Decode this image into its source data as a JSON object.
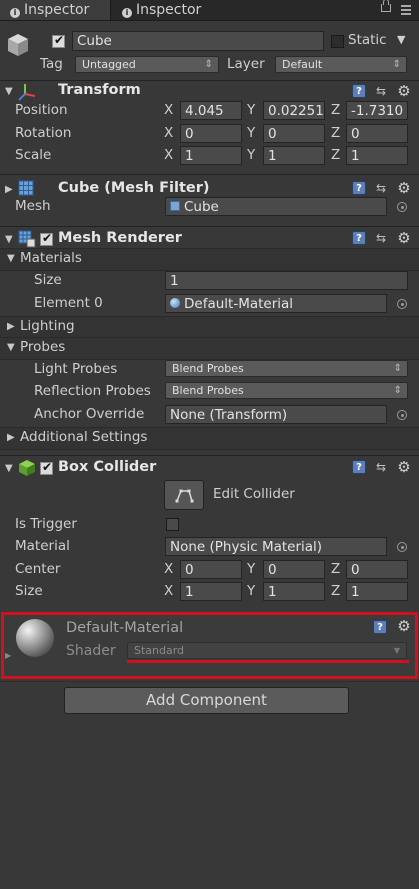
{
  "tabs": [
    {
      "label": "Inspector"
    },
    {
      "label": "Inspector"
    }
  ],
  "object": {
    "name": "Cube",
    "active": true,
    "static_label": "Static",
    "static": false,
    "tag_label": "Tag",
    "tag_value": "Untagged",
    "layer_label": "Layer",
    "layer_value": "Default"
  },
  "transform": {
    "title": "Transform",
    "rows": [
      {
        "label": "Position",
        "x": "4.045",
        "y": "0.02251",
        "z": "-1.7310"
      },
      {
        "label": "Rotation",
        "x": "0",
        "y": "0",
        "z": "0"
      },
      {
        "label": "Scale",
        "x": "1",
        "y": "1",
        "z": "1"
      }
    ],
    "axis": {
      "x": "X",
      "y": "Y",
      "z": "Z"
    }
  },
  "mesh_filter": {
    "title": "Cube (Mesh Filter)",
    "mesh_label": "Mesh",
    "mesh_value": "Cube"
  },
  "mesh_renderer": {
    "title": "Mesh Renderer",
    "enabled": true,
    "materials_label": "Materials",
    "size_label": "Size",
    "size_value": "1",
    "element0_label": "Element 0",
    "element0_value": "Default-Material",
    "lighting_label": "Lighting",
    "probes_label": "Probes",
    "light_probes_label": "Light Probes",
    "light_probes_value": "Blend Probes",
    "reflection_probes_label": "Reflection Probes",
    "reflection_probes_value": "Blend Probes",
    "anchor_override_label": "Anchor Override",
    "anchor_override_value": "None (Transform)",
    "additional_settings_label": "Additional Settings"
  },
  "box_collider": {
    "title": "Box Collider",
    "enabled": true,
    "edit_collider_label": "Edit Collider",
    "is_trigger_label": "Is Trigger",
    "is_trigger": false,
    "material_label": "Material",
    "material_value": "None (Physic Material)",
    "center_label": "Center",
    "center": {
      "x": "0",
      "y": "0",
      "z": "0"
    },
    "size_label": "Size",
    "size": {
      "x": "1",
      "y": "1",
      "z": "1"
    }
  },
  "material": {
    "name": "Default-Material",
    "shader_label": "Shader",
    "shader_value": "Standard",
    "highlight_color": "#d0121e"
  },
  "add_component_label": "Add Component",
  "colors": {
    "background": "#383838",
    "field": "#4a4a4a",
    "help_icon": "#5d7fb8",
    "highlight": "#d0121e"
  }
}
